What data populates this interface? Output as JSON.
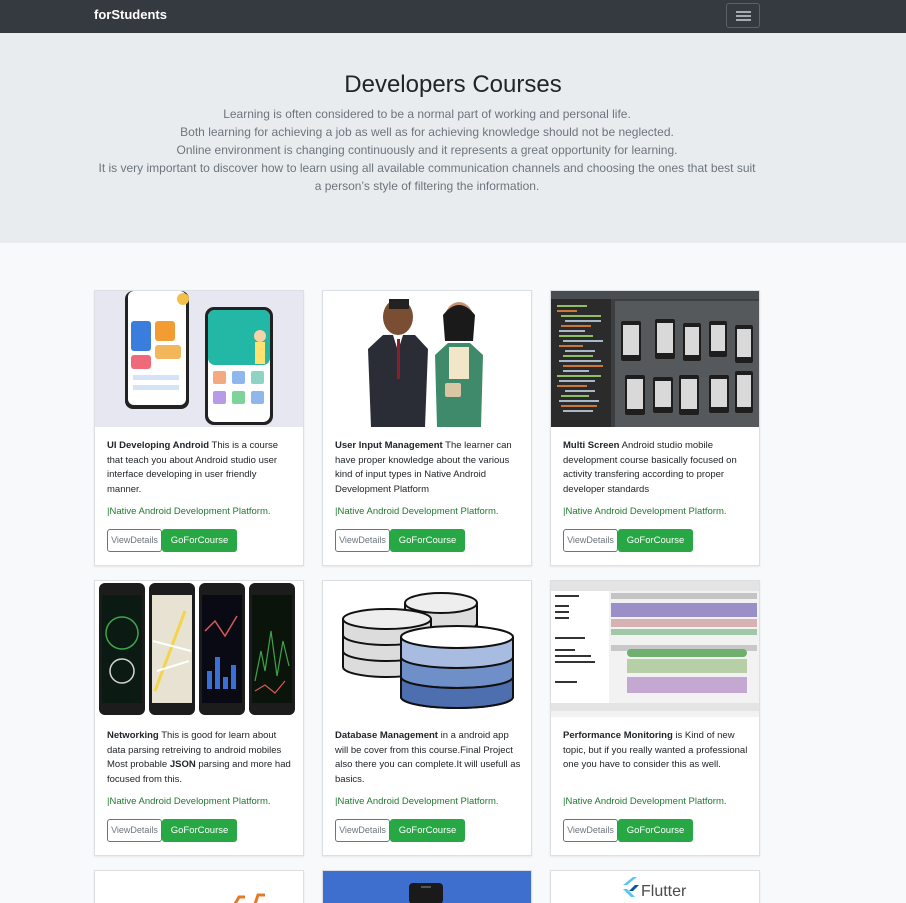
{
  "navbar": {
    "brand": "forStudents",
    "toggle_icon": "hamburger-icon"
  },
  "jumbotron": {
    "title": "Developers Courses",
    "lines": [
      "Learning is often considered to be a normal part of working and personal life.",
      "Both learning for achieving a job as well as for achieving knowledge should not be neglected.",
      "Online environment is changing continuously and it represents a great opportunity for learning.",
      "It is very important to discover how to learn using all available communication channels and choosing the ones that best suit a person’s style of filtering the information."
    ]
  },
  "buttons": {
    "view": "ViewDetails",
    "go": "GoForCourse"
  },
  "cards": [
    {
      "title": "UI Developing Android",
      "desc": " This is a course that teach you about Android studio user interface developing in user friendly manner.",
      "platform": "|Native Android Development Platform."
    },
    {
      "title": "User Input Management",
      "desc": " The learner can have proper knowledge about the various kind of input types in Native Android Development Platform",
      "platform": "|Native Android Development Platform."
    },
    {
      "title": "Multi Screen",
      "desc": " Android studio mobile development course basically focused on activity transfering according to proper developer standards",
      "platform": "|Native Android Development Platform."
    },
    {
      "title": "Networking",
      "desc_pre": " This is good for learn about data parsing retreiving to android mobiles Most probable ",
      "desc_bold": "JSON",
      "desc_post": " parsing and more had focused from this.",
      "platform": "|Native Android Development Platform."
    },
    {
      "title": "Database Management",
      "desc": " in a android app will be cover from this course.Final Project also there you can complete.It will usefull as basics.",
      "platform": "|Native Android Development Platform."
    },
    {
      "title": "Performance Monitoring",
      "desc": " is Kind of new topic, but if you really wanted a professional one you have to consider this as well.",
      "platform": "|Native Android Development Platform."
    }
  ],
  "partial_cards": {
    "flutter_label": "Flutter"
  },
  "colors": {
    "navbar": "#343a40",
    "jumbotron": "#e9ecef",
    "go_button": "#28a745",
    "platform_text": "#1f7a2e"
  }
}
